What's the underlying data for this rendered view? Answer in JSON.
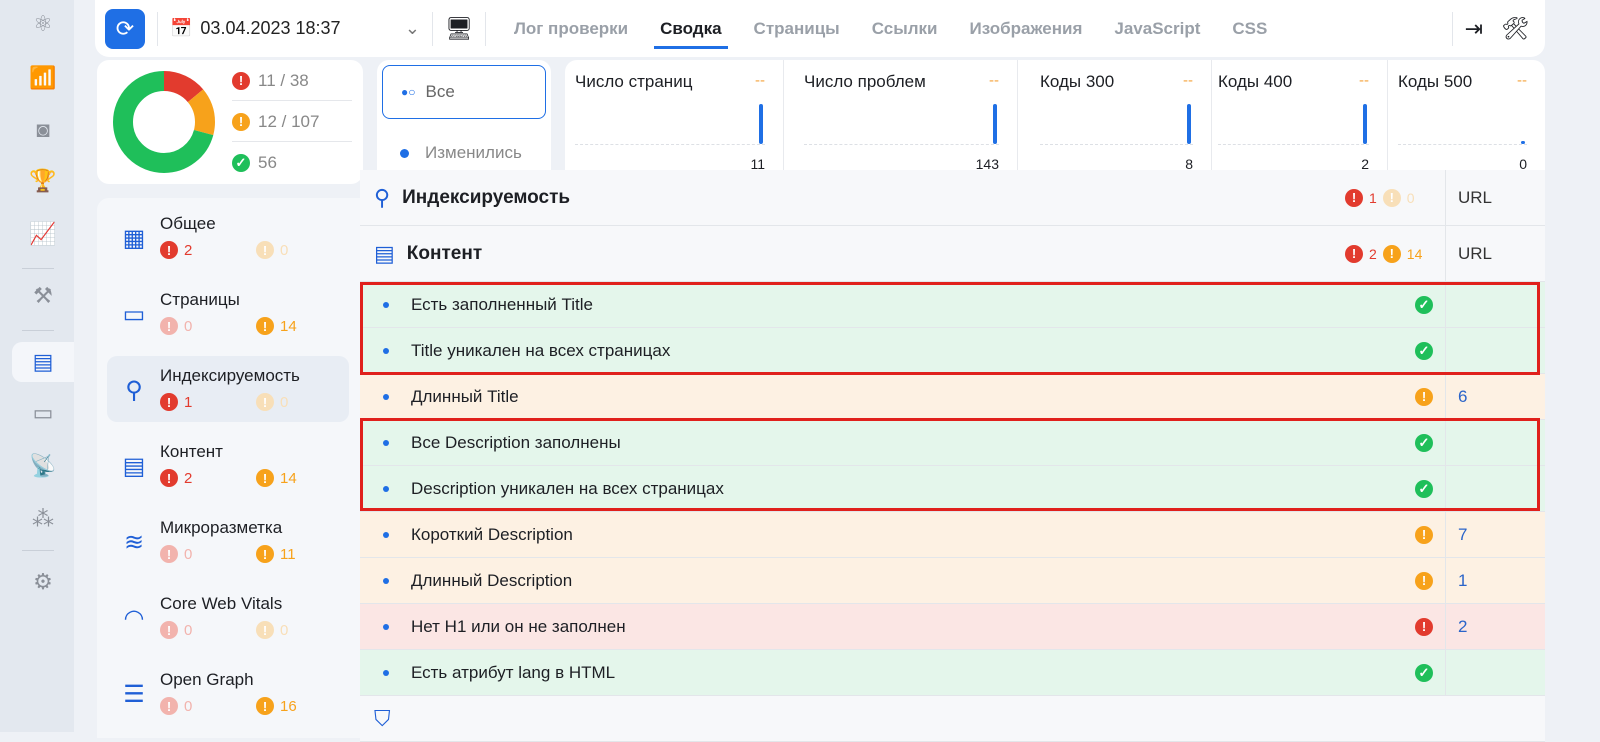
{
  "rail": {
    "items": [
      "atom-icon",
      "bar-chart-icon",
      "camera-scan-icon",
      "trophy-icon",
      "trend-chart-icon",
      "gavel-icon",
      "audit-icon",
      "inbox-icon",
      "satellite-icon",
      "sitemap-icon",
      "gear-icon"
    ],
    "active": "audit-icon"
  },
  "topbar": {
    "date": "03.04.2023 18:37",
    "tabs": [
      "Лог проверки",
      "Сводка",
      "Страницы",
      "Ссылки",
      "Изображения",
      "JavaScript",
      "CSS"
    ],
    "active_tab": "Сводка"
  },
  "summary": {
    "errors": "11 / 38",
    "warnings": "12 / 107",
    "ok": "56",
    "donut": {
      "errors": 11,
      "warnings": 12,
      "ok": 56
    },
    "colors": {
      "error": "#e23b2e",
      "warning": "#f7a21b",
      "ok": "#1fbf5a"
    }
  },
  "filter": {
    "all": "Все",
    "changed": "Изменились"
  },
  "stats": [
    {
      "title": "Число страниц",
      "delta": "--",
      "value": "11"
    },
    {
      "title": "Число проблем",
      "delta": "--",
      "value": "143"
    },
    {
      "title": "Коды 300",
      "delta": "--",
      "value": "8"
    },
    {
      "title": "Коды 400",
      "delta": "--",
      "value": "2"
    },
    {
      "title": "Коды 500",
      "delta": "--",
      "value": "0"
    }
  ],
  "sidebar": [
    {
      "name": "Общее",
      "err": "2",
      "warn": "0"
    },
    {
      "name": "Страницы",
      "err": "0",
      "warn": "14"
    },
    {
      "name": "Индексируемость",
      "err": "1",
      "warn": "0"
    },
    {
      "name": "Контент",
      "err": "2",
      "warn": "14"
    },
    {
      "name": "Микроразметка",
      "err": "0",
      "warn": "11"
    },
    {
      "name": "Core Web Vitals",
      "err": "0",
      "warn": "0"
    },
    {
      "name": "Open Graph",
      "err": "0",
      "warn": "16"
    }
  ],
  "table": {
    "url_header": "URL",
    "sections": [
      {
        "title": "Индексируемость",
        "err": "1",
        "warn": "0"
      },
      {
        "title": "Контент",
        "err": "2",
        "warn": "14"
      }
    ],
    "rows": [
      {
        "text": "Есть заполненный Title",
        "status": "ok",
        "url": ""
      },
      {
        "text": "Title уникален на всех страницах",
        "status": "ok",
        "url": ""
      },
      {
        "text": "Длинный Title",
        "status": "warning",
        "url": "6"
      },
      {
        "text": "Все Description заполнены",
        "status": "ok",
        "url": ""
      },
      {
        "text": "Description уникален на всех страницах",
        "status": "ok",
        "url": ""
      },
      {
        "text": "Короткий Description",
        "status": "warning",
        "url": "7"
      },
      {
        "text": "Длинный Description",
        "status": "warning",
        "url": "1"
      },
      {
        "text": "Нет H1 или он не заполнен",
        "status": "error",
        "url": "2"
      },
      {
        "text": "Есть атрибут lang в HTML",
        "status": "ok",
        "url": ""
      }
    ]
  }
}
